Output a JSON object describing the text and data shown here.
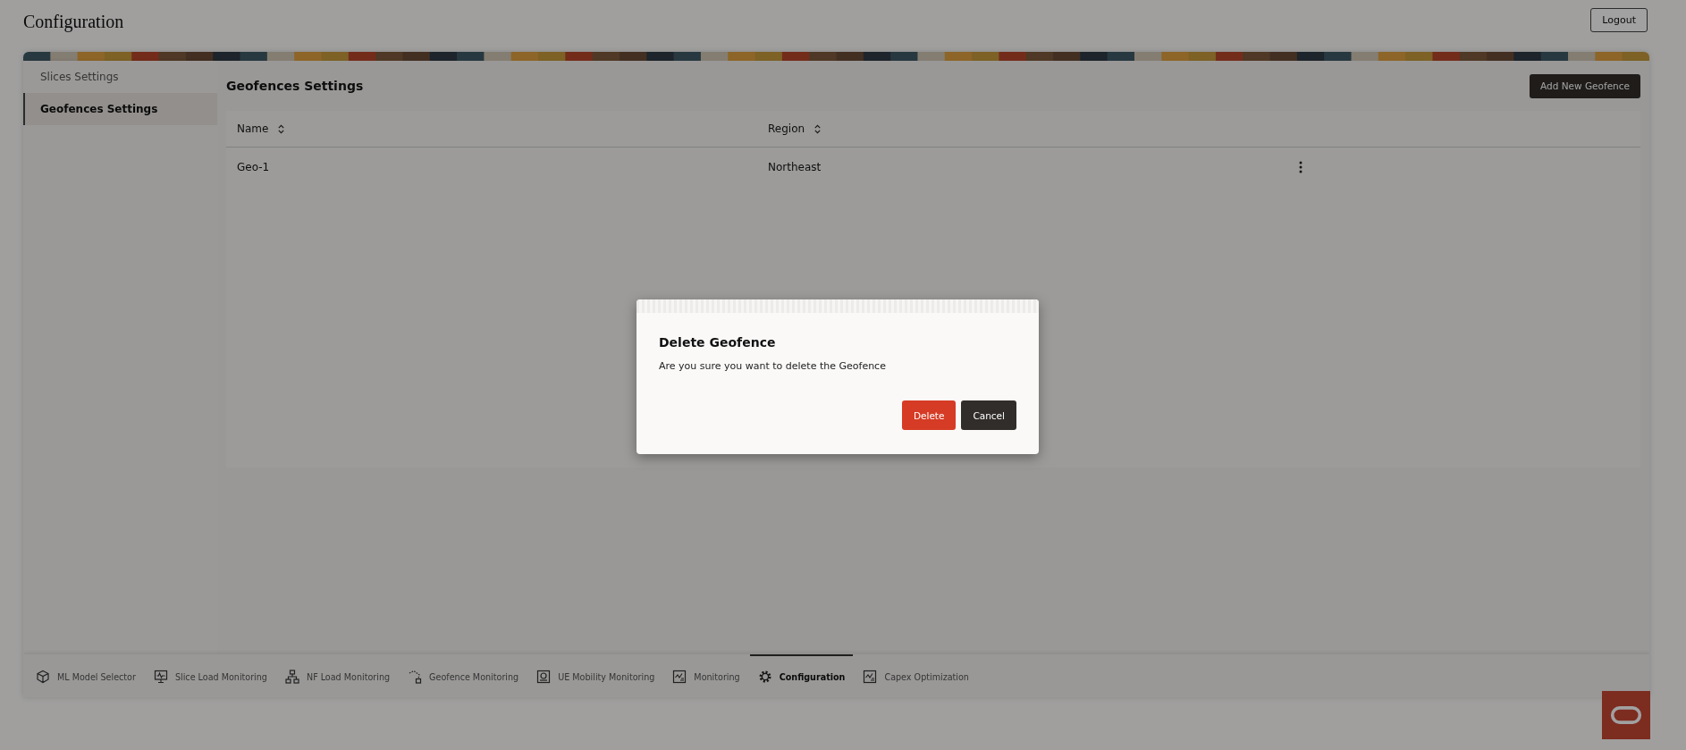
{
  "header": {
    "title": "Configuration",
    "logout": "Logout"
  },
  "sidebar": {
    "items": [
      {
        "label": "Slices Settings",
        "selected": false
      },
      {
        "label": "Geofences Settings",
        "selected": true
      }
    ]
  },
  "content": {
    "title": "Geofences Settings",
    "add_button": "Add New Geofence",
    "table": {
      "columns": [
        "Name",
        "Region"
      ],
      "rows": [
        {
          "cells": [
            "Geo-1",
            "Northeast"
          ]
        }
      ]
    }
  },
  "dialog": {
    "title": "Delete Geofence",
    "message": "Are you sure you want to delete the Geofence",
    "buttons": [
      {
        "label": "Delete",
        "kind": "danger"
      },
      {
        "label": "Cancel",
        "kind": "dark"
      }
    ]
  },
  "nav": {
    "tabs": [
      {
        "label": "ML Model Selector",
        "kind": "cube",
        "selected": false
      },
      {
        "label": "Slice Load Monitoring",
        "kind": "monitor",
        "selected": false
      },
      {
        "label": "NF Load Monitoring",
        "kind": "hierarchy",
        "selected": false
      },
      {
        "label": "Geofence Monitoring",
        "kind": "geofence",
        "selected": false
      },
      {
        "label": "UE Mobility Monitoring",
        "kind": "device",
        "selected": false
      },
      {
        "label": "Monitoring",
        "kind": "chart",
        "selected": false
      },
      {
        "label": "Configuration",
        "kind": "gear",
        "selected": true
      },
      {
        "label": "Capex Optimization",
        "kind": "chart",
        "selected": false
      }
    ]
  }
}
